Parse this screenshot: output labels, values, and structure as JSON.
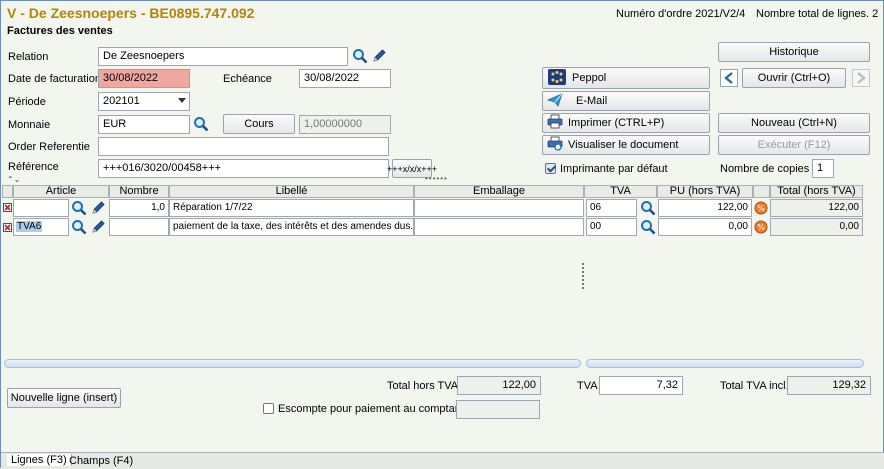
{
  "header": {
    "title": "V - De Zeesnoepers - BE0895.747.092",
    "subtitle": "Factures des ventes",
    "order_number": "Numéro d'ordre 2021/V2/4",
    "line_count": "Nombre total de lignes. 2"
  },
  "form": {
    "relation_label": "Relation",
    "relation_value": "De Zeesnoepers",
    "invoice_date_label": "Date de facturation",
    "invoice_date_value": "30/08/2022",
    "due_label": "Echéance",
    "due_value": "30/08/2022",
    "period_label": "Période",
    "period_value": "202101",
    "currency_label": "Monnaie",
    "currency_value": "EUR",
    "rate_button": "Cours",
    "rate_value": "1,00000000",
    "order_ref_label": "Order Referentie",
    "order_ref_value": "",
    "reference_label": "Référence",
    "reference_value": "+++016/3020/00458+++",
    "reference_button": "+++x/x/x+++"
  },
  "actions": {
    "history": "Historique",
    "peppol": "Peppol",
    "open": "Ouvrir (Ctrl+O)",
    "email": "E-Mail",
    "print": "Imprimer  (CTRL+P)",
    "new": "Nouveau (Ctrl+N)",
    "view_doc": "Visualiser le document",
    "execute": "Exécuter (F12)",
    "default_printer": "Imprimante par défaut",
    "copies_label": "Nombre de copies",
    "copies_value": "1"
  },
  "grid": {
    "columns": [
      "Article",
      "Nombre",
      "Libellé",
      "Emballage",
      "TVA",
      "PU (hors TVA)",
      "Total (hors TVA)"
    ],
    "rows": [
      {
        "article": "",
        "nombre": "1,0",
        "libelle": "Réparation 1/7/22",
        "emballage": "",
        "tva": "06",
        "pu": "122,00",
        "total": "122,00"
      },
      {
        "article": "TVA6",
        "nombre": "",
        "libelle": "paiement de la taxe, des intérêts et des amendes dus.",
        "emballage": "",
        "tva": "00",
        "pu": "0,00",
        "total": "0,00"
      }
    ]
  },
  "totals": {
    "excl_label": "Total hors TVA",
    "excl_value": "122,00",
    "vat_label": "TVA",
    "vat_value": "7,32",
    "incl_label": "Total TVA incl.",
    "incl_value": "129,32",
    "new_line_button": "Nouvelle ligne (insert)",
    "discount_label": "Escompte pour paiement au comptant",
    "discount_value": ""
  },
  "tabs": [
    "Lignes (F3)",
    "Champs (F4)"
  ],
  "colors": {
    "title": "#b58400",
    "error_field": "#f2a6a0",
    "background": "#f3f6ef",
    "delete_icon": "#cc1f1f"
  }
}
